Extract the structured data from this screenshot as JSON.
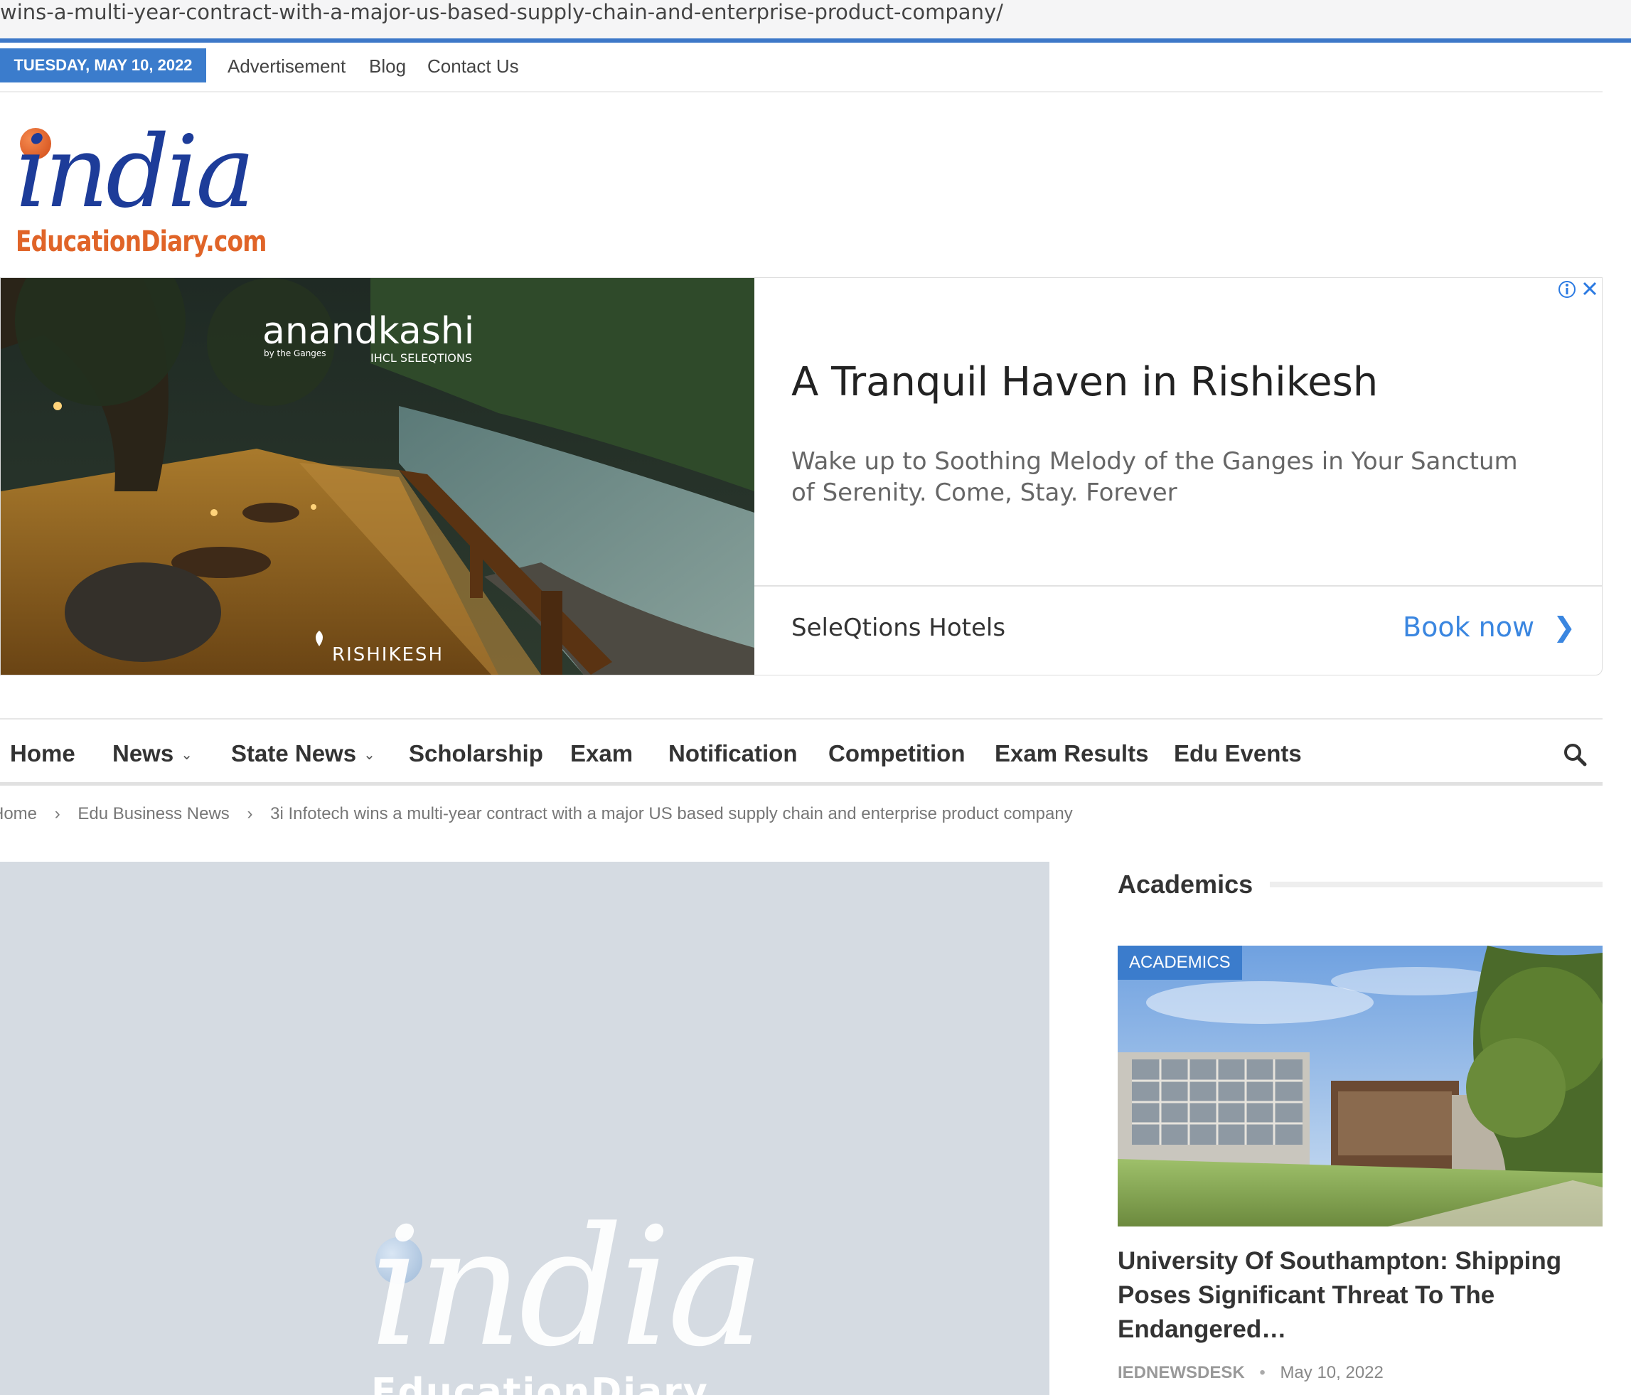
{
  "browser": {
    "url_fragment": "wins-a-multi-year-contract-with-a-major-us-based-supply-chain-and-enterprise-product-company/"
  },
  "topbar": {
    "date": "TUESDAY, MAY 10, 2022",
    "links": [
      "Advertisement",
      "Blog",
      "Contact Us"
    ]
  },
  "logo": {
    "main": "india",
    "sub": "EducationDiary.com"
  },
  "ad": {
    "image_brand": "anandkashi",
    "image_tagline": "by the Ganges",
    "image_partner": "IHCL SELEQTIONS",
    "image_location": "RISHIKESH",
    "title": "A Tranquil Haven in Rishikesh",
    "description": "Wake up to Soothing Melody of the Ganges in Your Sanctum of Serenity. Come, Stay. Forever",
    "advertiser": "SeleQtions Hotels",
    "cta": "Book now"
  },
  "nav": {
    "items": [
      {
        "label": "Home"
      },
      {
        "label": "News",
        "has_dropdown": true
      },
      {
        "label": "State News",
        "has_dropdown": true
      },
      {
        "label": "Scholarship"
      },
      {
        "label": "Exam"
      },
      {
        "label": "Notification"
      },
      {
        "label": "Competition"
      },
      {
        "label": "Exam Results"
      },
      {
        "label": "Edu Events"
      }
    ],
    "search_icon": "search-icon"
  },
  "breadcrumb": {
    "items": [
      "Home",
      "Edu Business News",
      "3i Infotech wins a multi-year contract with a major US based supply chain and enterprise product company"
    ]
  },
  "featured": {
    "watermark_main": "india",
    "watermark_sub": "EducationDiary"
  },
  "sidebar": {
    "heading": "Academics",
    "card": {
      "badge": "ACADEMICS",
      "title": "University Of Southampton: Shipping Poses Significant Threat To The Endangered…",
      "author": "IEDNEWSDESK",
      "date": "May 10, 2022"
    }
  },
  "colors": {
    "accent": "#3b7ccc",
    "logo_blue": "#1d3c99",
    "logo_orange": "#e06428",
    "cta_blue": "#3a86e0"
  }
}
